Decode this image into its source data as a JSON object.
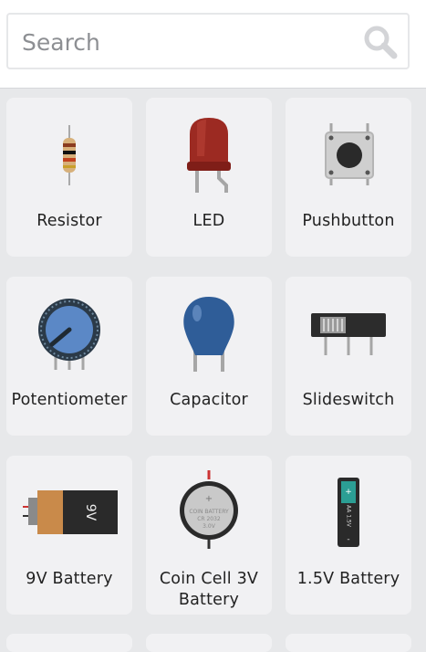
{
  "search": {
    "placeholder": "Search",
    "value": ""
  },
  "components": [
    {
      "label": "Resistor",
      "icon": "resistor-icon"
    },
    {
      "label": "LED",
      "icon": "led-icon"
    },
    {
      "label": "Pushbutton",
      "icon": "pushbutton-icon"
    },
    {
      "label": "Potentiometer",
      "icon": "potentiometer-icon"
    },
    {
      "label": "Capacitor",
      "icon": "capacitor-icon"
    },
    {
      "label": "Slideswitch",
      "icon": "slideswitch-icon"
    },
    {
      "label": "9V Battery",
      "icon": "battery-9v-icon",
      "marking": "9V"
    },
    {
      "label": "Coin Cell 3V Battery",
      "icon": "coin-cell-battery-icon",
      "marking_lines": [
        "COIN BATTERY",
        "CR 2032",
        "3.0V"
      ]
    },
    {
      "label": "1.5V Battery",
      "icon": "aa-battery-icon",
      "marking": "AA 1.5V"
    }
  ],
  "colors": {
    "background": "#e7e8ea",
    "tile": "#f1f1f3",
    "led_red": "#9c2a22",
    "capacitor_blue": "#2f5d98",
    "potentiometer_blue": "#5b88c6",
    "battery_copper": "#c98a4a",
    "aa_teal": "#2b9e94"
  }
}
